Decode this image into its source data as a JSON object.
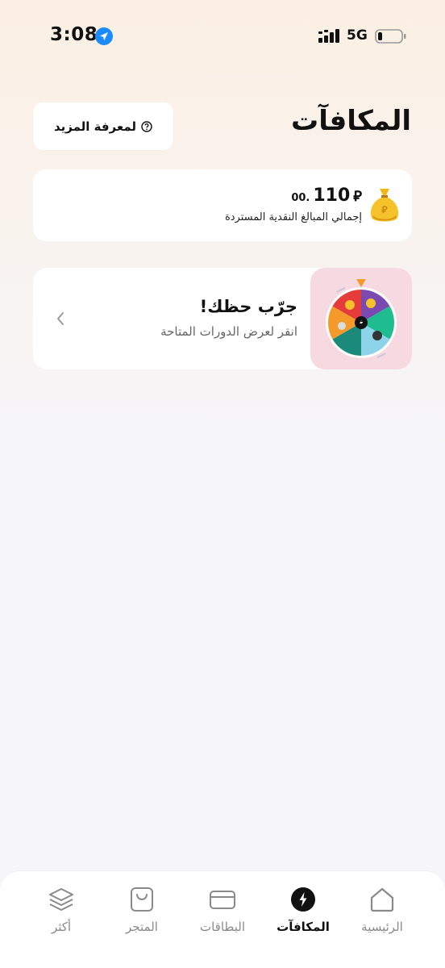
{
  "status_bar": {
    "time": "3:08",
    "network": "5G",
    "icons": [
      "location-arrow-icon",
      "signal-icon",
      "battery-icon"
    ]
  },
  "header": {
    "title": "المكافآت",
    "learn_more_label": "لمعرفة المزيد",
    "learn_more_icon": "question-circle-icon"
  },
  "cashback": {
    "amount_int": "110",
    "amount_dec": ".00",
    "currency_symbol": "⃁",
    "label": "إجمالي المبالغ النقدية المستردة",
    "icon": "money-bag-icon"
  },
  "wheel": {
    "title": "جرّب حظك!",
    "subtitle": "انقر لعرض الدورات المتاحة",
    "icon": "prize-wheel-icon"
  },
  "bottom_nav": {
    "items": [
      {
        "label": "الرئيسية",
        "icon": "home-icon",
        "active": false
      },
      {
        "label": "المكافآت",
        "icon": "rewards-icon",
        "active": true
      },
      {
        "label": "البطاقات",
        "icon": "card-icon",
        "active": false
      },
      {
        "label": "المتجر",
        "icon": "shopping-bag-icon",
        "active": false
      },
      {
        "label": "أكثر",
        "icon": "layers-icon",
        "active": false
      }
    ]
  },
  "colors": {
    "accent": "#111111",
    "inactive": "#8a8a8a",
    "wheel_bg": "#f7d9e2"
  }
}
